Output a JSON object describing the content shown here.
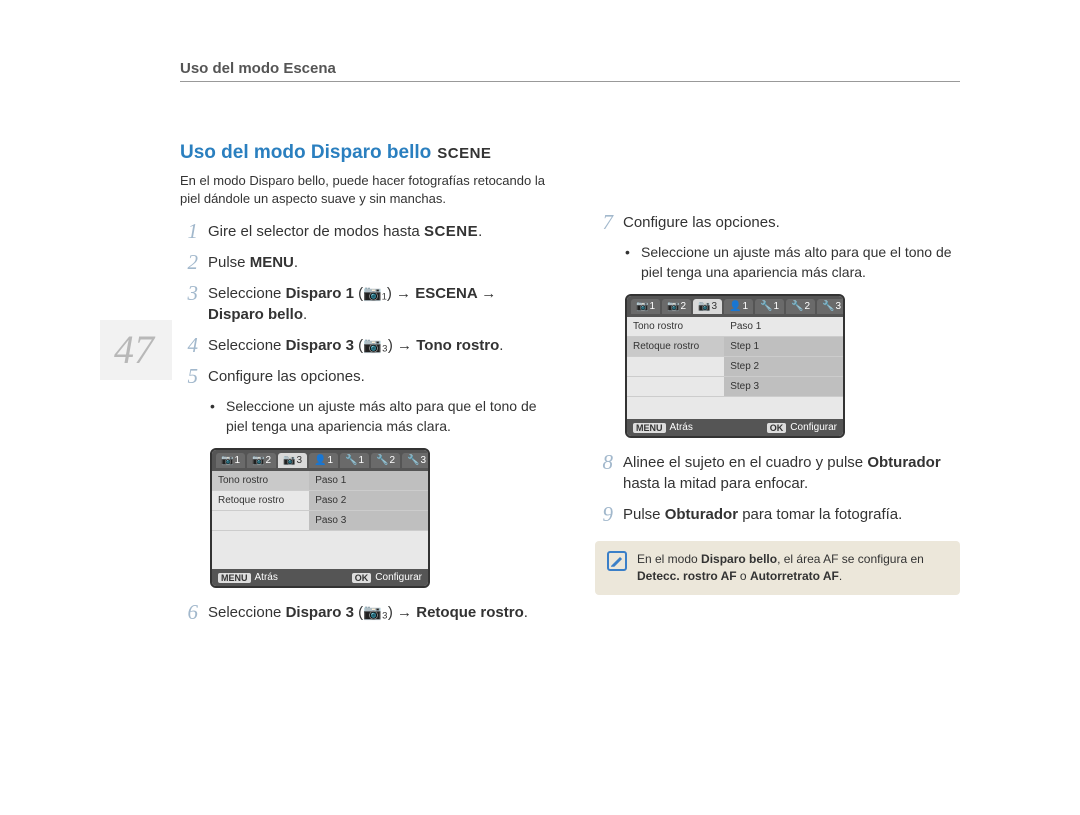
{
  "header": {
    "breadcrumb": "Uso del modo Escena"
  },
  "page_number": "47",
  "title": "Uso del modo Disparo bello",
  "title_badge": "SCENE",
  "intro": "En el modo Disparo bello, puede hacer fotografías retocando la piel dándole un aspecto suave y sin manchas.",
  "steps": {
    "s1": {
      "num": "1",
      "t1": "Gire el selector de modos hasta ",
      "t2": "."
    },
    "s2": {
      "num": "2",
      "t1": "Pulse ",
      "b1": "MENU",
      "t2": "."
    },
    "s3": {
      "num": "3",
      "t1": "Seleccione ",
      "b1": "Disparo 1",
      "t2": " (",
      "t3": ") → ",
      "b2": "ESCENA → Disparo bello",
      "t4": "."
    },
    "s4": {
      "num": "4",
      "t1": "Seleccione ",
      "b1": "Disparo 3",
      "t2": " (",
      "t3": ") → ",
      "b2": "Tono rostro",
      "t4": "."
    },
    "s5": {
      "num": "5",
      "t1": "Configure las opciones."
    },
    "s5_bullet": "Seleccione un ajuste más alto para que el tono de piel tenga una apariencia más clara.",
    "s6": {
      "num": "6",
      "t1": "Seleccione ",
      "b1": "Disparo 3",
      "t2": " (",
      "t3": ") → ",
      "b2": "Retoque rostro",
      "t4": "."
    },
    "s7": {
      "num": "7",
      "t1": "Configure las opciones."
    },
    "s7_bullet": "Seleccione un ajuste más alto para que el tono de piel tenga una apariencia más clara.",
    "s8": {
      "num": "8",
      "t1": "Alinee el sujeto en el cuadro y pulse ",
      "b1": "Obturador",
      "t2": " hasta la mitad para enfocar."
    },
    "s9": {
      "num": "9",
      "t1": "Pulse ",
      "b1": "Obturador",
      "t2": " para tomar la fotografía."
    }
  },
  "lcd1": {
    "tabs": {
      "c1": "1",
      "c2": "2",
      "c3": "3",
      "p1": "1",
      "s1": "1",
      "s2": "2",
      "s3": "3"
    },
    "row1": {
      "left": "Tono rostro",
      "right": "Paso 1"
    },
    "row2": {
      "left": "Retoque rostro",
      "right": "Paso 2"
    },
    "row3": {
      "left": "",
      "right": "Paso 3"
    },
    "foot": {
      "menu": "MENU",
      "back": "Atrás",
      "ok": "OK",
      "set": "Configurar"
    }
  },
  "lcd2": {
    "row1": {
      "left": "Tono rostro",
      "right": "Paso 1"
    },
    "row2": {
      "left": "Retoque rostro",
      "right": "Step 1"
    },
    "row3": {
      "left": "",
      "right": "Step 2"
    },
    "row4": {
      "left": "",
      "right": "Step 3"
    },
    "foot": {
      "menu": "MENU",
      "back": "Atrás",
      "ok": "OK",
      "set": "Configurar"
    }
  },
  "note": {
    "t1": "En el modo ",
    "b1": "Disparo bello",
    "t2": ", el área AF se configura en ",
    "b2": "Detecc. rostro AF",
    "t3": " o ",
    "b3": "Autorretrato AF",
    "t4": "."
  }
}
